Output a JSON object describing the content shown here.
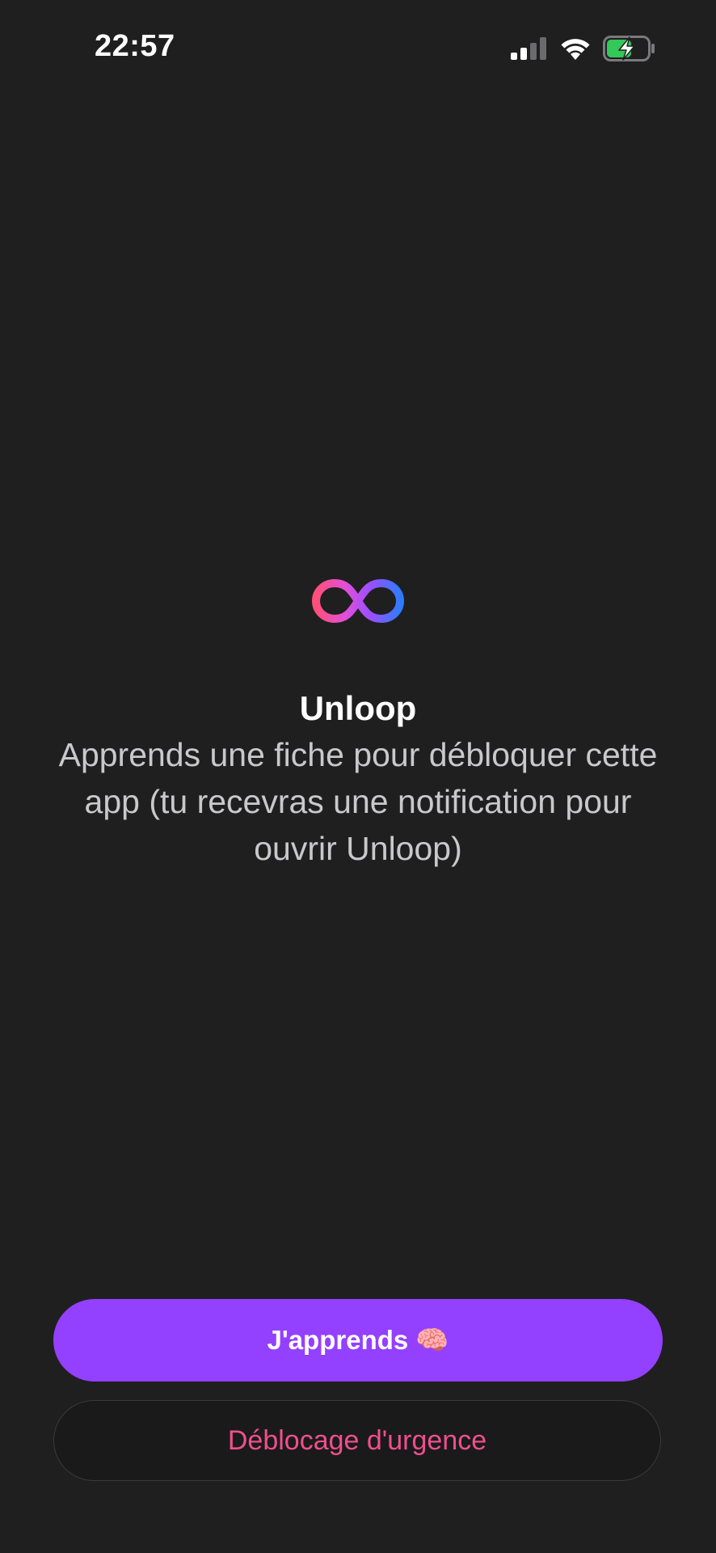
{
  "status_bar": {
    "time": "22:57",
    "icons": [
      "cellular-signal-icon",
      "wifi-icon",
      "battery-charging-icon"
    ]
  },
  "app": {
    "logo_icon": "infinity-icon",
    "title": "Unloop",
    "message": "Apprends une fiche pour débloquer cette app (tu recevras une notification pour ouvrir Unloop)"
  },
  "actions": {
    "primary_label": "J'apprends 🧠",
    "secondary_label": "Déblocage d'urgence"
  },
  "colors": {
    "background": "#1f1f20",
    "primary_button": "#9440ff",
    "secondary_text": "#ef4f8c",
    "battery_fill": "#34c759"
  }
}
